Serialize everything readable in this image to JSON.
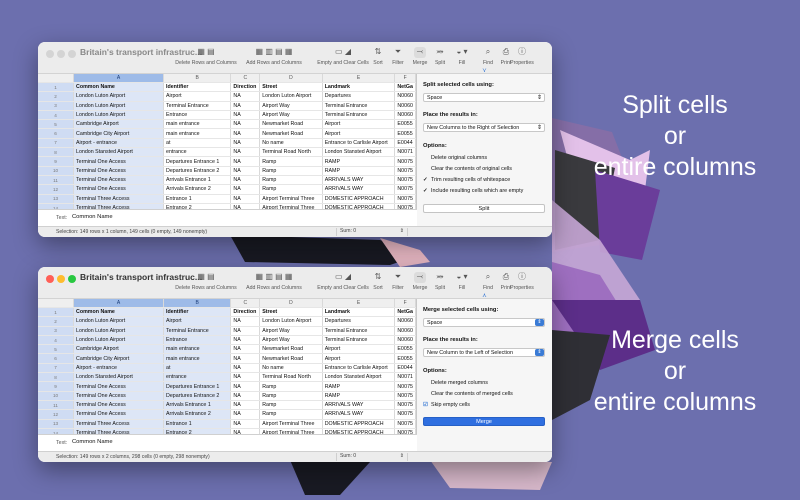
{
  "colors": {
    "background": "#6c6fae",
    "selection": "#dde6f6",
    "accent": "#2f6fe0"
  },
  "captions": {
    "split": [
      "Split cells",
      "or",
      "entire columns"
    ],
    "merge": [
      "Merge cells",
      "or",
      "entire columns"
    ]
  },
  "toolbar": [
    {
      "icon": "table-delete-icon",
      "label": "Delete Rows and Columns"
    },
    {
      "icon": "table-add-icon",
      "label": "Add Rows and Columns"
    },
    {
      "icon": "eraser-icon",
      "label": "Empty and Clear Cells"
    },
    {
      "icon": "sort-icon",
      "label": "Sort"
    },
    {
      "icon": "filter-icon",
      "label": "Filter"
    },
    {
      "icon": "merge-icon",
      "label": "Merge"
    },
    {
      "icon": "split-icon",
      "label": "Split"
    },
    {
      "icon": "fill-icon",
      "label": "Fill"
    },
    {
      "icon": "find-icon",
      "label": "Find"
    },
    {
      "icon": "print-icon",
      "label": "Print"
    },
    {
      "icon": "info-icon",
      "label": "Properties"
    }
  ],
  "columns": [
    "A",
    "B",
    "C",
    "D",
    "E",
    "F"
  ],
  "rows": [
    [
      "Common Name",
      "Identifier",
      "Direction",
      "Street",
      "Landmark",
      "NetGa"
    ],
    [
      "London Luton Airport",
      "Airport",
      "NA",
      "London Luton Airport",
      "Departures",
      "N0060"
    ],
    [
      "London Luton Airport",
      "Terminal Entrance",
      "NA",
      "Airport Way",
      "Terminal Entrance",
      "N0060"
    ],
    [
      "London Luton Airport",
      "Entrance",
      "NA",
      "Airport Way",
      "Terminal Entrance",
      "N0060"
    ],
    [
      "Cambridge Airport",
      "main entrance",
      "NA",
      "Newmarket Road",
      "Airport",
      "E0055"
    ],
    [
      "Cambridge City Airport",
      "main entrance",
      "NA",
      "Newmarket Road",
      "Airport",
      "E0055"
    ],
    [
      "Airport - entrance",
      "at",
      "NA",
      "No name",
      "Entrance to Carlisle Airport",
      "E0044"
    ],
    [
      "London Stansted Airport",
      "entrance",
      "NA",
      "Terminal Road North",
      "London Stansted Airport",
      "N0071"
    ],
    [
      "Terminal One Access",
      "Departures Entrance 1",
      "NA",
      "Ramp",
      "RAMP",
      "N0075"
    ],
    [
      "Terminal One Access",
      "Departures Entrance 2",
      "NA",
      "Ramp",
      "RAMP",
      "N0075"
    ],
    [
      "Terminal One Access",
      "Arrivals Entrance 1",
      "NA",
      "Ramp",
      "ARRIVALS WAY",
      "N0075"
    ],
    [
      "Terminal One Access",
      "Arrivals Entrance 2",
      "NA",
      "Ramp",
      "ARRIVALS WAY",
      "N0075"
    ],
    [
      "Terminal Three Access",
      "Entrance 1",
      "NA",
      "Airport Terminal Three",
      "DOMESTIC APPROACH",
      "N0075"
    ],
    [
      "Terminal Three Access",
      "Entrance 2",
      "NA",
      "Airport Terminal Three",
      "DOMESTIC APPROACH",
      "N0075"
    ]
  ],
  "win1": {
    "title": "Britain's transport infrastruc...",
    "text_label": "Text:",
    "text_value": "Common Name",
    "selection": "Selection: 149 rows x 1 column, 149 cells (0 empty, 149 nonempty)",
    "sum": "Sum: 0",
    "panel": {
      "heading": "Split selected cells using:",
      "sep_value": "Space",
      "place_heading": "Place the results in:",
      "place_value": "New Columns to the Right of Selection",
      "options_heading": "Options:",
      "options": [
        {
          "label": "Delete original columns",
          "checked": false
        },
        {
          "label": "Clear the contents of original cells",
          "checked": false
        },
        {
          "label": "Trim resulting cells of whitespace",
          "checked": true
        },
        {
          "label": "Include resulting cells which are empty",
          "checked": true
        }
      ],
      "button": "Split"
    }
  },
  "win2": {
    "title": "Britain's transport infrastruc...",
    "text_label": "Text:",
    "text_value": "Common Name",
    "selection": "Selection: 149 rows x 2 columns, 298 cells (0 empty, 298 nonempty)",
    "sum": "Sum: 0",
    "panel": {
      "heading": "Merge selected cells using:",
      "sep_value": "Space",
      "place_heading": "Place the results in:",
      "place_value": "New Column to the Left of Selection",
      "options_heading": "Options:",
      "options": [
        {
          "label": "Delete merged columns",
          "checked": false
        },
        {
          "label": "Clear the contents of merged cells",
          "checked": false
        },
        {
          "label": "Skip empty cells",
          "checked": true
        }
      ],
      "button": "Merge"
    }
  }
}
